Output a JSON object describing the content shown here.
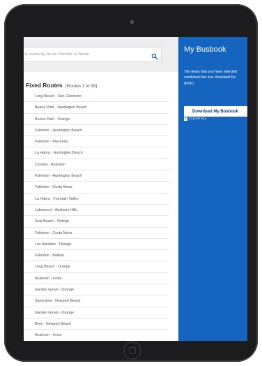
{
  "search": {
    "placeholder": "h routes by Route Number or Name"
  },
  "routes_section": {
    "title": "Fixed Routes",
    "subtitle": "(Routes 1 to 99)"
  },
  "routes": [
    "Long Beach - San Clemente",
    "Buena Park - Huntington Beach",
    "Buena Park - Orange",
    "Fullerton - Huntington Beach",
    "Fullerton - Placentia",
    "La Habra - Huntington Beach",
    "Cerritos - Anaheim",
    "Fullerton - Huntington Beach",
    "Fullerton - Costa Mesa",
    "La Habra - Fountain Valley",
    "Lakewood - Anaheim Hills",
    "Seal Beach - Orange",
    "Fullerton - Costa Mesa",
    "Los Alamitos - Orange",
    "Fullerton - Balboa",
    "Long Beach - Orange",
    "Anaheim - Irvine",
    "Garden Grove - Orange",
    "Santa Ana - Newport Beach",
    "Garden Grove - Orange",
    "Brea - Newport Beach",
    "Anaheim - Irvine"
  ],
  "busbook": {
    "title": "My Busbook",
    "description_lines": [
      "The items that you have selected",
      "combined into one document for",
      "(PDF)."
    ],
    "download_label": "Download My Busbook",
    "clear_label": "CLEAR ALL"
  },
  "colors": {
    "panel_blue": "#1464c0",
    "search_icon_blue": "#1a6cc4",
    "device_frame": "#1c1c1e"
  }
}
